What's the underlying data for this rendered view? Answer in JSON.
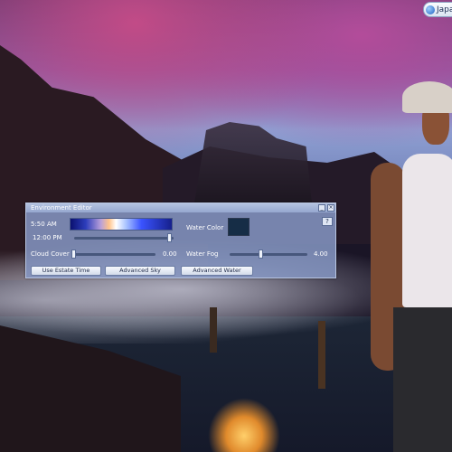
{
  "top_tab": {
    "label": "Japa"
  },
  "env_editor": {
    "title": "Environment Editor",
    "minimize_glyph": "_",
    "close_glyph": "×",
    "help_glyph": "?",
    "time_of_day": "5:50 AM",
    "time_slider_label": "12:00 PM",
    "time_slider_position": 0.94,
    "cloud_cover_label": "Cloud Cover",
    "cloud_cover_value": "0.00",
    "water_color_label": "Water Color",
    "water_color": "#162d46",
    "water_fog_label": "Water Fog",
    "water_fog_value": "4.00",
    "buttons": {
      "estate_time": "Use Estate Time",
      "advanced_sky": "Advanced Sky",
      "advanced_water": "Advanced Water"
    }
  }
}
